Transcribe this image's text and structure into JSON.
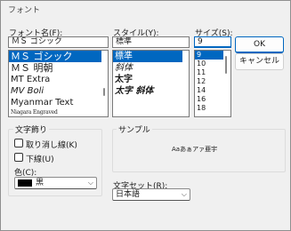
{
  "window": {
    "title": "フォント"
  },
  "font": {
    "label": "フォント名(F):",
    "value": "ＭＳ ゴシック",
    "items": [
      "ＭＳ ゴシック",
      "ＭＳ 明朝",
      "MT Extra",
      "MV Boli",
      "Myanmar Text",
      "Niagara Engraved"
    ]
  },
  "style": {
    "label": "スタイル(Y):",
    "value": "標準",
    "items": [
      "標準",
      "斜体",
      "太字",
      "太字 斜体"
    ]
  },
  "size": {
    "label": "サイズ(S):",
    "value": "9",
    "items": [
      "9",
      "10",
      "11",
      "12",
      "14",
      "16",
      "18"
    ]
  },
  "buttons": {
    "ok": "OK",
    "cancel": "キャンセル"
  },
  "effects": {
    "group_label": "文字飾り",
    "strikeout": "取り消し線(K)",
    "underline": "下線(U)",
    "color_label": "色(C):",
    "color_value": "黒",
    "color_hex": "#000000"
  },
  "sample": {
    "group_label": "サンプル",
    "text": "Aaあぁアァ亜宇"
  },
  "charset": {
    "label": "文字セット(R):",
    "value": "日本語"
  }
}
